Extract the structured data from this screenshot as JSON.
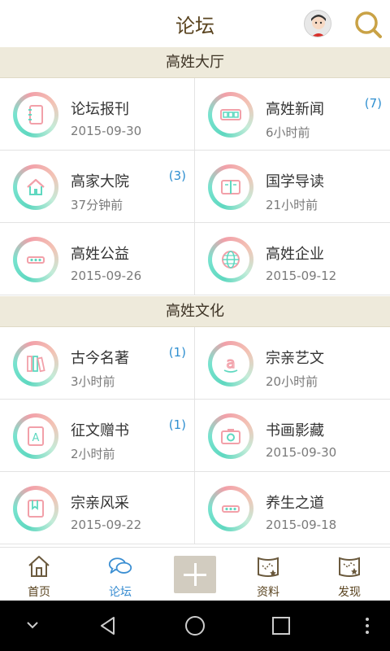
{
  "header": {
    "title": "论坛"
  },
  "sections": [
    {
      "title": "高姓大厅",
      "items": [
        {
          "name": "论坛报刊",
          "time": "2015-09-30",
          "badge": "",
          "icon": "notebook-icon"
        },
        {
          "name": "高姓新闻",
          "time": "6小时前",
          "badge": "(7)",
          "icon": "newspaper-icon"
        },
        {
          "name": "高家大院",
          "time": "37分钟前",
          "badge": "(3)",
          "icon": "house-icon"
        },
        {
          "name": "国学导读",
          "time": "21小时前",
          "badge": "",
          "icon": "book-icon"
        },
        {
          "name": "高姓公益",
          "time": "2015-09-26",
          "badge": "",
          "icon": "dots-icon"
        },
        {
          "name": "高姓企业",
          "time": "2015-09-12",
          "badge": "",
          "icon": "globe-icon"
        }
      ]
    },
    {
      "title": "高姓文化",
      "items": [
        {
          "name": "古今名著",
          "time": "3小时前",
          "badge": "(1)",
          "icon": "books-icon"
        },
        {
          "name": "宗亲艺文",
          "time": "20小时前",
          "badge": "",
          "icon": "letter-a-icon"
        },
        {
          "name": "征文赠书",
          "time": "2小时前",
          "badge": "(1)",
          "icon": "document-a-icon"
        },
        {
          "name": "书画影藏",
          "time": "2015-09-30",
          "badge": "",
          "icon": "camera-icon"
        },
        {
          "name": "宗亲风采",
          "time": "2015-09-22",
          "badge": "",
          "icon": "bookmark-icon"
        },
        {
          "name": "养生之道",
          "time": "2015-09-18",
          "badge": "",
          "icon": "dots-icon"
        }
      ]
    }
  ],
  "nav": [
    {
      "label": "首页",
      "icon": "home-icon",
      "active": false
    },
    {
      "label": "论坛",
      "icon": "chat-bubbles-icon",
      "active": true
    },
    {
      "label": "资料",
      "icon": "map-icon",
      "active": false
    },
    {
      "label": "发现",
      "icon": "map-star-icon",
      "active": false
    }
  ],
  "colors": {
    "accent": "#3a8ed2",
    "header_bg": "#eeeadb",
    "title": "#5a4420",
    "badge": "#2f8fd0"
  }
}
